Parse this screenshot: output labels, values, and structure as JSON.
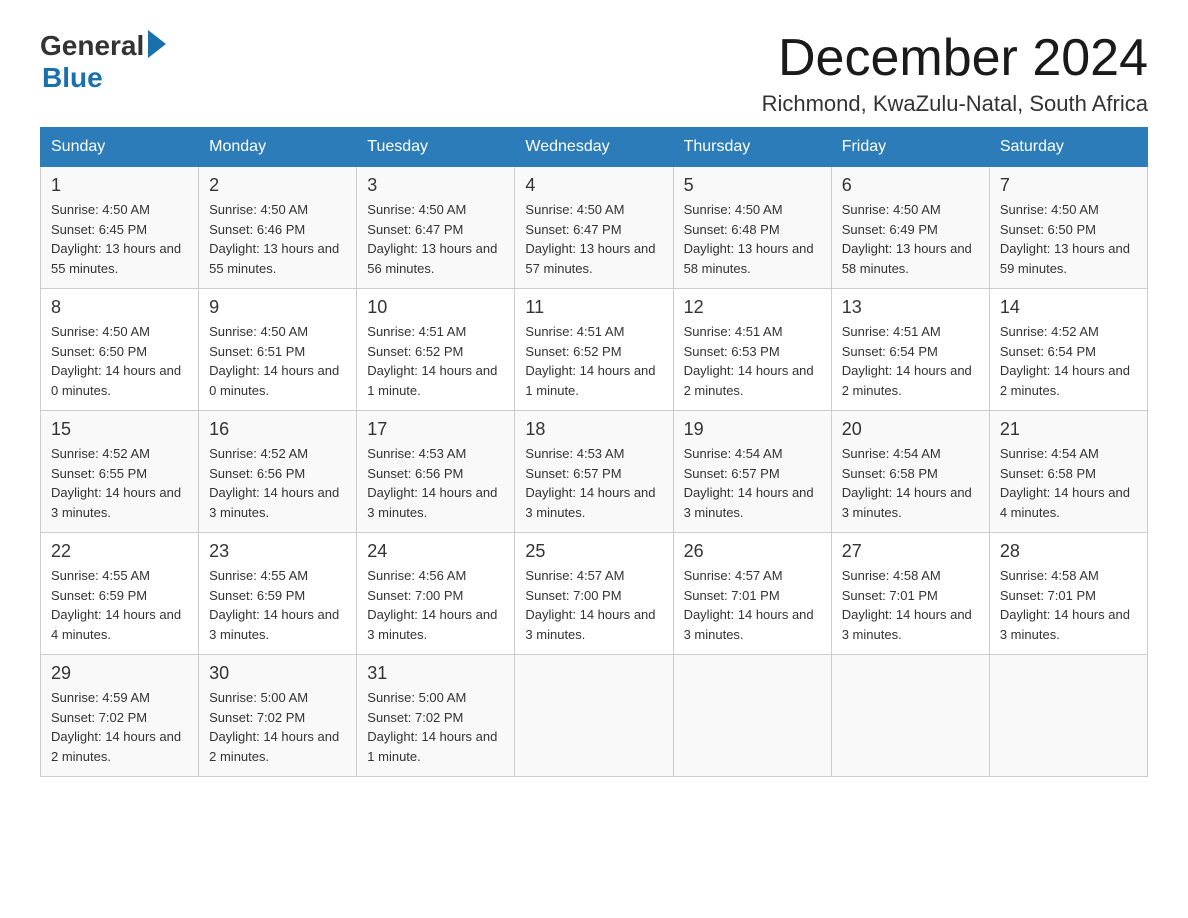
{
  "header": {
    "logo_general": "General",
    "logo_blue": "Blue",
    "month_title": "December 2024",
    "location": "Richmond, KwaZulu-Natal, South Africa"
  },
  "weekdays": [
    "Sunday",
    "Monday",
    "Tuesday",
    "Wednesday",
    "Thursday",
    "Friday",
    "Saturday"
  ],
  "weeks": [
    [
      {
        "day": "1",
        "sunrise": "4:50 AM",
        "sunset": "6:45 PM",
        "daylight": "13 hours and 55 minutes."
      },
      {
        "day": "2",
        "sunrise": "4:50 AM",
        "sunset": "6:46 PM",
        "daylight": "13 hours and 55 minutes."
      },
      {
        "day": "3",
        "sunrise": "4:50 AM",
        "sunset": "6:47 PM",
        "daylight": "13 hours and 56 minutes."
      },
      {
        "day": "4",
        "sunrise": "4:50 AM",
        "sunset": "6:47 PM",
        "daylight": "13 hours and 57 minutes."
      },
      {
        "day": "5",
        "sunrise": "4:50 AM",
        "sunset": "6:48 PM",
        "daylight": "13 hours and 58 minutes."
      },
      {
        "day": "6",
        "sunrise": "4:50 AM",
        "sunset": "6:49 PM",
        "daylight": "13 hours and 58 minutes."
      },
      {
        "day": "7",
        "sunrise": "4:50 AM",
        "sunset": "6:50 PM",
        "daylight": "13 hours and 59 minutes."
      }
    ],
    [
      {
        "day": "8",
        "sunrise": "4:50 AM",
        "sunset": "6:50 PM",
        "daylight": "14 hours and 0 minutes."
      },
      {
        "day": "9",
        "sunrise": "4:50 AM",
        "sunset": "6:51 PM",
        "daylight": "14 hours and 0 minutes."
      },
      {
        "day": "10",
        "sunrise": "4:51 AM",
        "sunset": "6:52 PM",
        "daylight": "14 hours and 1 minute."
      },
      {
        "day": "11",
        "sunrise": "4:51 AM",
        "sunset": "6:52 PM",
        "daylight": "14 hours and 1 minute."
      },
      {
        "day": "12",
        "sunrise": "4:51 AM",
        "sunset": "6:53 PM",
        "daylight": "14 hours and 2 minutes."
      },
      {
        "day": "13",
        "sunrise": "4:51 AM",
        "sunset": "6:54 PM",
        "daylight": "14 hours and 2 minutes."
      },
      {
        "day": "14",
        "sunrise": "4:52 AM",
        "sunset": "6:54 PM",
        "daylight": "14 hours and 2 minutes."
      }
    ],
    [
      {
        "day": "15",
        "sunrise": "4:52 AM",
        "sunset": "6:55 PM",
        "daylight": "14 hours and 3 minutes."
      },
      {
        "day": "16",
        "sunrise": "4:52 AM",
        "sunset": "6:56 PM",
        "daylight": "14 hours and 3 minutes."
      },
      {
        "day": "17",
        "sunrise": "4:53 AM",
        "sunset": "6:56 PM",
        "daylight": "14 hours and 3 minutes."
      },
      {
        "day": "18",
        "sunrise": "4:53 AM",
        "sunset": "6:57 PM",
        "daylight": "14 hours and 3 minutes."
      },
      {
        "day": "19",
        "sunrise": "4:54 AM",
        "sunset": "6:57 PM",
        "daylight": "14 hours and 3 minutes."
      },
      {
        "day": "20",
        "sunrise": "4:54 AM",
        "sunset": "6:58 PM",
        "daylight": "14 hours and 3 minutes."
      },
      {
        "day": "21",
        "sunrise": "4:54 AM",
        "sunset": "6:58 PM",
        "daylight": "14 hours and 4 minutes."
      }
    ],
    [
      {
        "day": "22",
        "sunrise": "4:55 AM",
        "sunset": "6:59 PM",
        "daylight": "14 hours and 4 minutes."
      },
      {
        "day": "23",
        "sunrise": "4:55 AM",
        "sunset": "6:59 PM",
        "daylight": "14 hours and 3 minutes."
      },
      {
        "day": "24",
        "sunrise": "4:56 AM",
        "sunset": "7:00 PM",
        "daylight": "14 hours and 3 minutes."
      },
      {
        "day": "25",
        "sunrise": "4:57 AM",
        "sunset": "7:00 PM",
        "daylight": "14 hours and 3 minutes."
      },
      {
        "day": "26",
        "sunrise": "4:57 AM",
        "sunset": "7:01 PM",
        "daylight": "14 hours and 3 minutes."
      },
      {
        "day": "27",
        "sunrise": "4:58 AM",
        "sunset": "7:01 PM",
        "daylight": "14 hours and 3 minutes."
      },
      {
        "day": "28",
        "sunrise": "4:58 AM",
        "sunset": "7:01 PM",
        "daylight": "14 hours and 3 minutes."
      }
    ],
    [
      {
        "day": "29",
        "sunrise": "4:59 AM",
        "sunset": "7:02 PM",
        "daylight": "14 hours and 2 minutes."
      },
      {
        "day": "30",
        "sunrise": "5:00 AM",
        "sunset": "7:02 PM",
        "daylight": "14 hours and 2 minutes."
      },
      {
        "day": "31",
        "sunrise": "5:00 AM",
        "sunset": "7:02 PM",
        "daylight": "14 hours and 1 minute."
      },
      null,
      null,
      null,
      null
    ]
  ]
}
